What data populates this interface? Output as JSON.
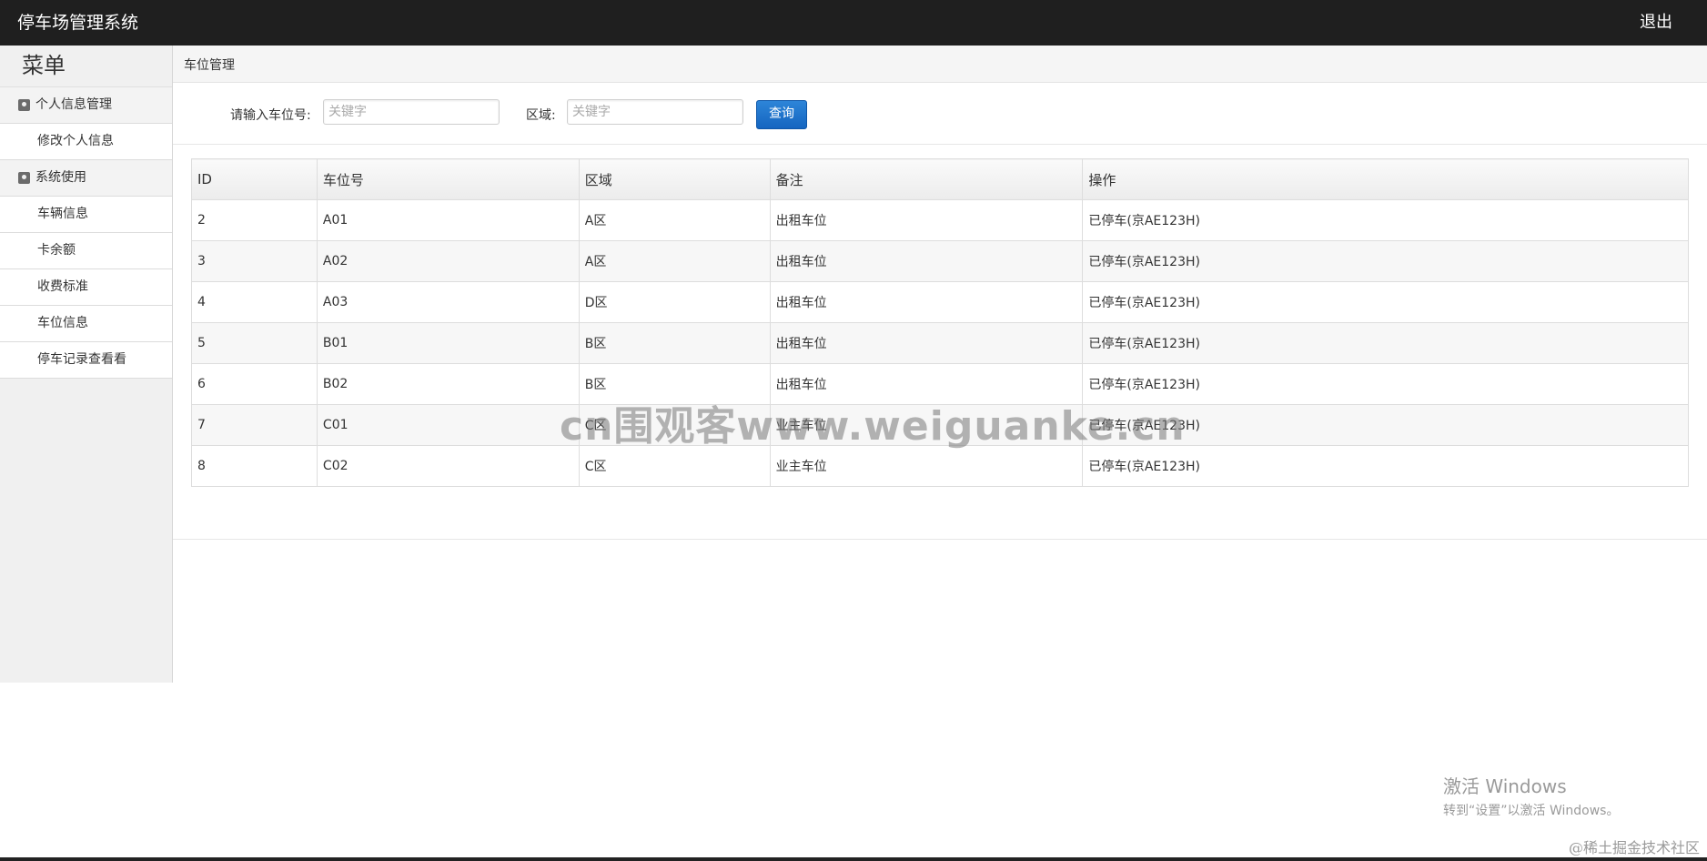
{
  "app": {
    "title": "停车场管理系统",
    "logout_label": "退出"
  },
  "sidebar": {
    "menu_title": "菜单",
    "groups": [
      {
        "label": "个人信息管理",
        "items": [
          "修改个人信息"
        ]
      },
      {
        "label": "系统使用",
        "items": [
          "车辆信息",
          "卡余额",
          "收费标准",
          "车位信息",
          "停车记录查看看"
        ]
      }
    ]
  },
  "breadcrumb": "车位管理",
  "search": {
    "spot_label": "请输入车位号:",
    "spot_placeholder": "关键字",
    "area_label": "区域:",
    "area_placeholder": "关键字",
    "query_label": "查询"
  },
  "table": {
    "headers": [
      "ID",
      "车位号",
      "区域",
      "备注",
      "操作"
    ],
    "rows": [
      [
        "2",
        "A01",
        "A区",
        "出租车位",
        "已停车(京AE123H)"
      ],
      [
        "3",
        "A02",
        "A区",
        "出租车位",
        "已停车(京AE123H)"
      ],
      [
        "4",
        "A03",
        "D区",
        "出租车位",
        "已停车(京AE123H)"
      ],
      [
        "5",
        "B01",
        "B区",
        "出租车位",
        "已停车(京AE123H)"
      ],
      [
        "6",
        "B02",
        "B区",
        "出租车位",
        "已停车(京AE123H)"
      ],
      [
        "7",
        "C01",
        "C区",
        "业主车位",
        "已停车(京AE123H)"
      ],
      [
        "8",
        "C02",
        "C区",
        "业主车位",
        "已停车(京AE123H)"
      ]
    ]
  },
  "overlays": {
    "watermark": "cn围观客www.weiguanke.cn",
    "windows_activate_line1": "激活 Windows",
    "windows_activate_line2": "转到“设置”以激活 Windows。",
    "juejin": "@稀土掘金技术社区"
  }
}
